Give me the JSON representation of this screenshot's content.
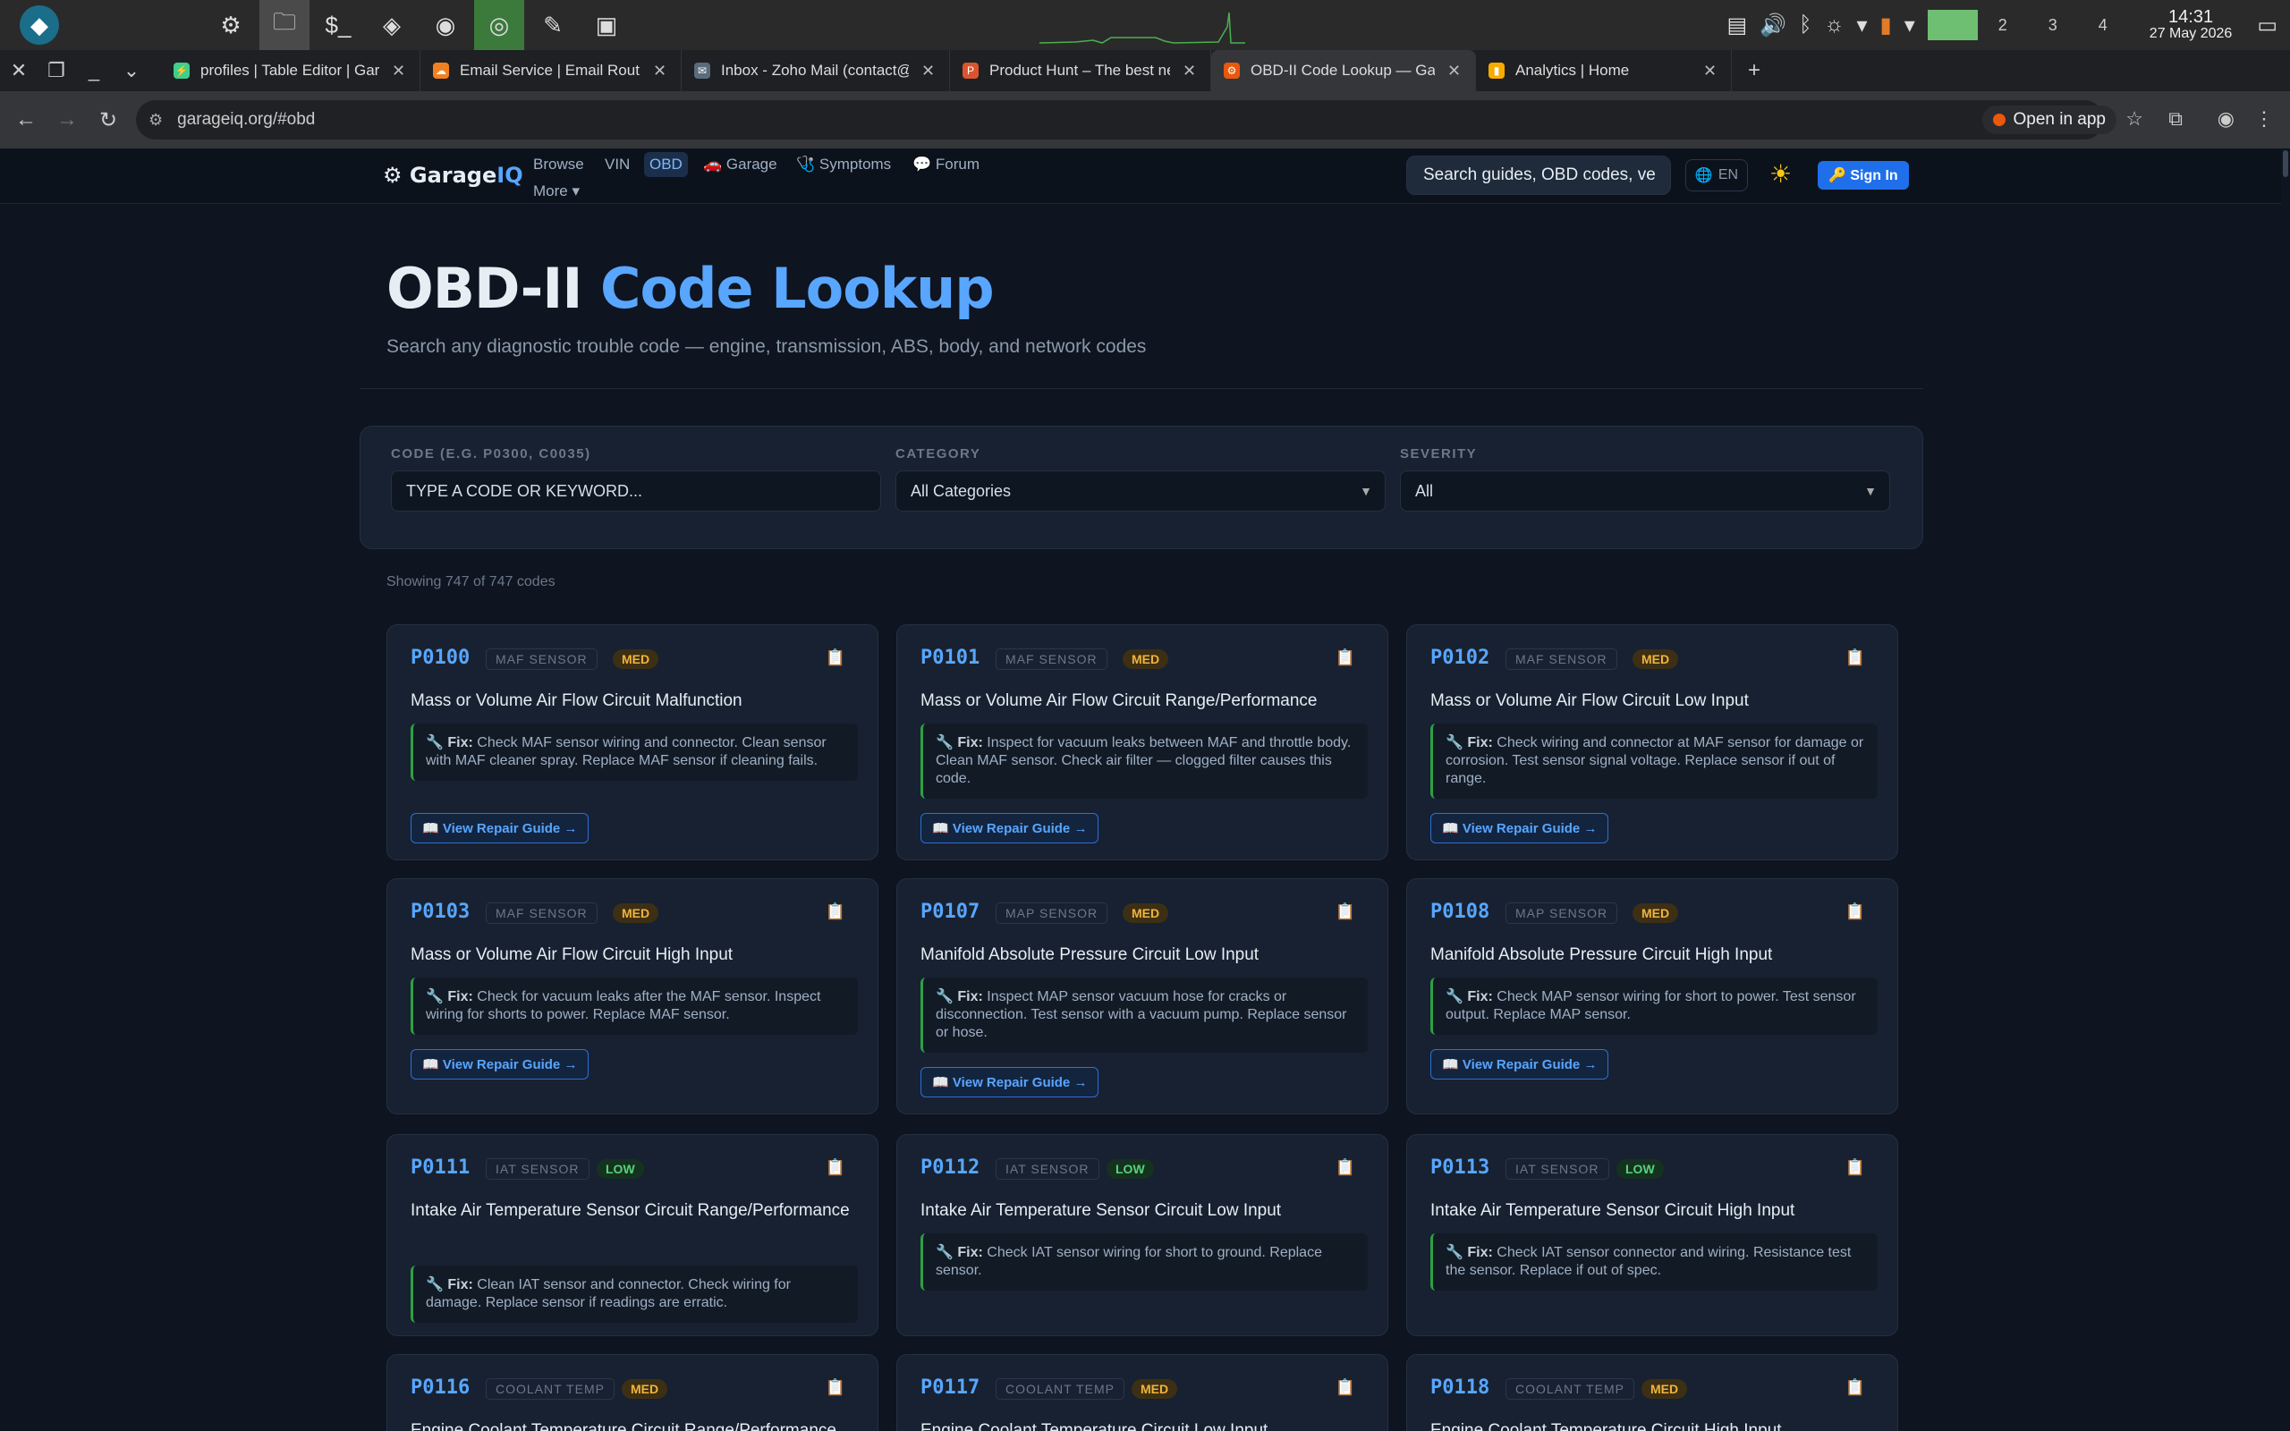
{
  "taskbar": {
    "apps": [
      {
        "icon": "settings-icon",
        "glyph": "⚙"
      },
      {
        "icon": "files-icon",
        "glyph": "🗀"
      },
      {
        "icon": "terminal-icon",
        "glyph": "$_"
      },
      {
        "icon": "vscode-icon",
        "glyph": "◈"
      },
      {
        "icon": "firefox-icon",
        "glyph": "◉"
      },
      {
        "icon": "chrome-icon",
        "glyph": "◎"
      },
      {
        "icon": "editor-icon",
        "glyph": "✎"
      },
      {
        "icon": "screen-icon",
        "glyph": "▣"
      }
    ],
    "workspaces": [
      "",
      "2",
      "3",
      "4"
    ],
    "time": "14:31",
    "date": "27 May 2026"
  },
  "tabs": [
    {
      "title": "profiles | Table Editor | Gar",
      "color": "#3ecf8e",
      "glyph": "⚡",
      "active": false
    },
    {
      "title": "Email Service | Email Routi",
      "color": "#f38020",
      "glyph": "☁",
      "active": false
    },
    {
      "title": "Inbox - Zoho Mail (contact@",
      "color": "#5a6b7c",
      "glyph": "✉",
      "active": false
    },
    {
      "title": "Product Hunt – The best ne",
      "color": "#da552f",
      "glyph": "P",
      "active": false
    },
    {
      "title": "OBD-II Code Lookup — Gar",
      "color": "#ea580c",
      "glyph": "⚙",
      "active": true
    },
    {
      "title": "Analytics | Home",
      "color": "#f9ab00",
      "glyph": "▮",
      "active": false
    }
  ],
  "address": {
    "url": "garageiq.org/#obd",
    "open_in_app": "Open in app"
  },
  "site": {
    "logo_main": "Garage",
    "logo_accent": "IQ",
    "nav": [
      "Browse",
      "VIN",
      "OBD",
      "🚗 Garage",
      "🩺 Symptoms",
      "💬 Forum",
      "More ▾"
    ],
    "search_placeholder": "Search guides, OBD codes, ve",
    "lang": "EN",
    "sign_in": "🔑 Sign In"
  },
  "hero": {
    "title_main": "OBD-II ",
    "title_accent": "Code Lookup",
    "subtitle": "Search any diagnostic trouble code — engine, transmission, ABS, body, and network codes"
  },
  "filters": {
    "code_label": "CODE (E.G. P0300, C0035)",
    "code_placeholder": "Type a code or keyword...",
    "category_label": "CATEGORY",
    "category_value": "All Categories",
    "severity_label": "SEVERITY",
    "severity_value": "All"
  },
  "results": {
    "showing": "Showing 747 of 747 codes"
  },
  "fix_prefix": "Fix:",
  "guide_label": "📖 View Repair Guide →",
  "colors": {
    "accent": "#58a6ff",
    "med": "#f0b43c",
    "low": "#56d37a",
    "fix_border": "#2ea043"
  },
  "cards": [
    {
      "code": "P0100",
      "category": "MAF SENSOR",
      "severity": "MED",
      "description": "Mass or Volume Air Flow Circuit Malfunction",
      "fix": "Check MAF sensor wiring and connector. Clean sensor with MAF cleaner spray. Replace MAF sensor if cleaning fails.",
      "guide": true
    },
    {
      "code": "P0101",
      "category": "MAF SENSOR",
      "severity": "MED",
      "description": "Mass or Volume Air Flow Circuit Range/Performance",
      "fix": "Inspect for vacuum leaks between MAF and throttle body. Clean MAF sensor. Check air filter — clogged filter causes this code.",
      "guide": true
    },
    {
      "code": "P0102",
      "category": "MAF SENSOR",
      "severity": "MED",
      "description": "Mass or Volume Air Flow Circuit Low Input",
      "fix": "Check wiring and connector at MAF sensor for damage or corrosion. Test sensor signal voltage. Replace sensor if out of range.",
      "guide": true
    },
    {
      "code": "P0103",
      "category": "MAF SENSOR",
      "severity": "MED",
      "description": "Mass or Volume Air Flow Circuit High Input",
      "fix": "Check for vacuum leaks after the MAF sensor. Inspect wiring for shorts to power. Replace MAF sensor.",
      "guide": true
    },
    {
      "code": "P0107",
      "category": "MAP SENSOR",
      "severity": "MED",
      "description": "Manifold Absolute Pressure Circuit Low Input",
      "fix": "Inspect MAP sensor vacuum hose for cracks or disconnection. Test sensor with a vacuum pump. Replace sensor or hose.",
      "guide": true
    },
    {
      "code": "P0108",
      "category": "MAP SENSOR",
      "severity": "MED",
      "description": "Manifold Absolute Pressure Circuit High Input",
      "fix": "Check MAP sensor wiring for short to power. Test sensor output. Replace MAP sensor.",
      "guide": true
    },
    {
      "code": "P0111",
      "category": "IAT SENSOR",
      "severity": "LOW",
      "description": "Intake Air Temperature Sensor Circuit Range/Performance",
      "fix": "Clean IAT sensor and connector. Check wiring for damage. Replace sensor if readings are erratic.",
      "guide": false
    },
    {
      "code": "P0112",
      "category": "IAT SENSOR",
      "severity": "LOW",
      "description": "Intake Air Temperature Sensor Circuit Low Input",
      "fix": "Check IAT sensor wiring for short to ground. Replace sensor.",
      "guide": false
    },
    {
      "code": "P0113",
      "category": "IAT SENSOR",
      "severity": "LOW",
      "description": "Intake Air Temperature Sensor Circuit High Input",
      "fix": "Check IAT sensor connector and wiring. Resistance test the sensor. Replace if out of spec.",
      "guide": false
    },
    {
      "code": "P0116",
      "category": "COOLANT TEMP",
      "severity": "MED",
      "description": "Engine Coolant Temperature Circuit Range/Performance",
      "fix": "",
      "guide": false
    },
    {
      "code": "P0117",
      "category": "COOLANT TEMP",
      "severity": "MED",
      "description": "Engine Coolant Temperature Circuit Low Input",
      "fix": "",
      "guide": false
    },
    {
      "code": "P0118",
      "category": "COOLANT TEMP",
      "severity": "MED",
      "description": "Engine Coolant Temperature Circuit High Input",
      "fix": "",
      "guide": false
    }
  ]
}
